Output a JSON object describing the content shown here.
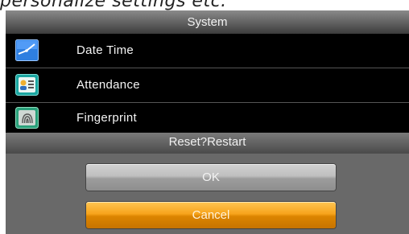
{
  "caption": {
    "text": "personalize settings etc."
  },
  "screen": {
    "title": "System",
    "menu": [
      {
        "label": "Date Time",
        "icon": "clock-icon"
      },
      {
        "label": "Attendance",
        "icon": "attendance-icon"
      },
      {
        "label": "Fingerprint",
        "icon": "fingerprint-icon"
      }
    ]
  },
  "dialog": {
    "title": "Reset?Restart",
    "ok_label": "OK",
    "cancel_label": "Cancel"
  },
  "colors": {
    "titlebar": "#5c5c5c",
    "dialog_bg": "#696969",
    "ok_button": "#b0b0b0",
    "cancel_button": "#f0a020"
  }
}
